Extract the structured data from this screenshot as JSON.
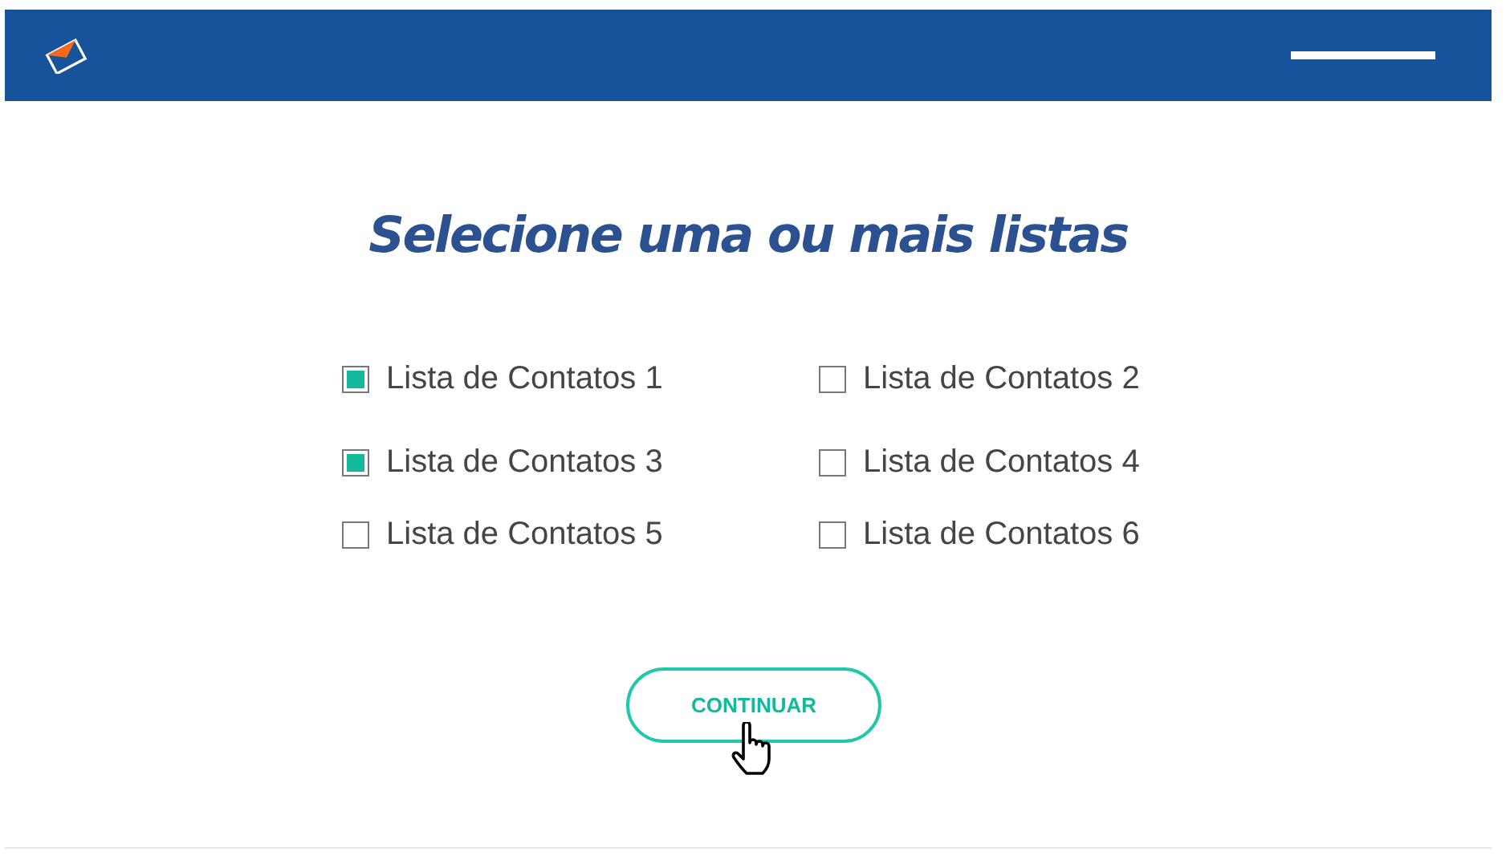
{
  "title": "Selecione uma ou mais listas",
  "lists": [
    {
      "label": "Lista de Contatos 1",
      "checked": true
    },
    {
      "label": "Lista de Contatos 2",
      "checked": false
    },
    {
      "label": "Lista de Contatos 3",
      "checked": true
    },
    {
      "label": "Lista de Contatos 4",
      "checked": false
    },
    {
      "label": "Lista de Contatos 5",
      "checked": false
    },
    {
      "label": "Lista de Contatos 6",
      "checked": false
    }
  ],
  "button": {
    "label": "CONTINUAR"
  }
}
